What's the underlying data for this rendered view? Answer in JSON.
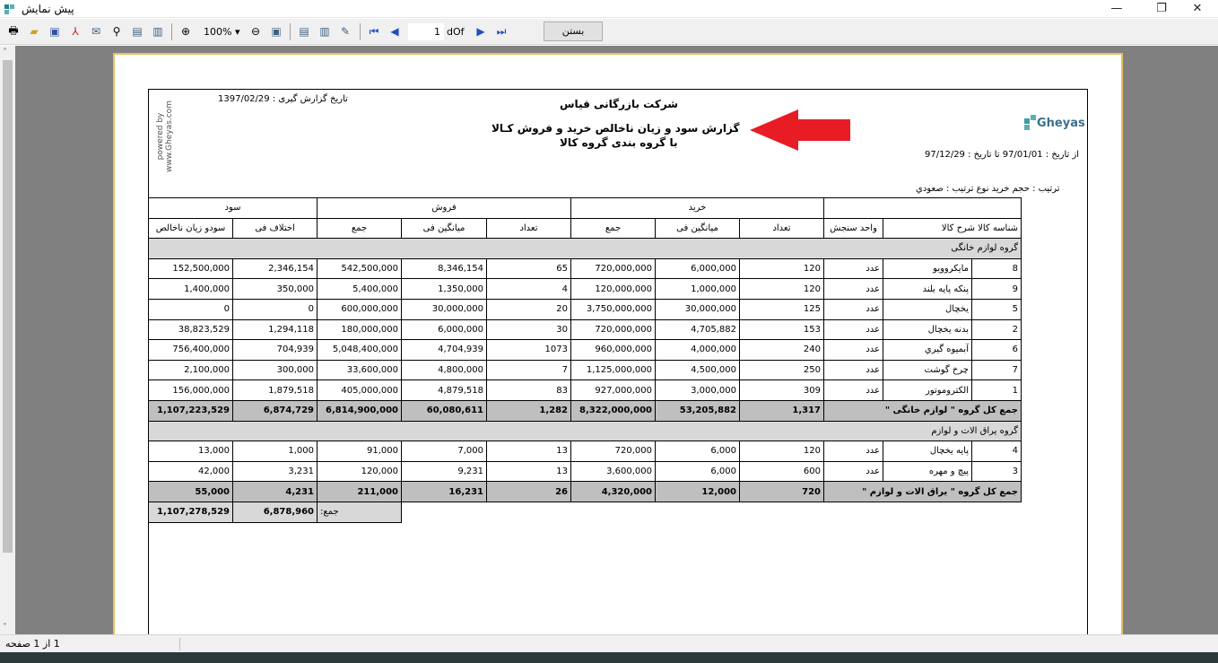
{
  "window": {
    "title": "پیش نمایش"
  },
  "toolbar": {
    "zoom": "100%",
    "page": "1",
    "of": "dOf",
    "close_label": "بستن"
  },
  "report": {
    "company": "شرکت بازرگانی قیاس",
    "title_line1": "گزارش سود و زیان ناخالص خرید و فروش کـالا",
    "title_line2": "با گروه بندی گروه کالا",
    "report_date": "تاریخ گزارش گیری : 1397/02/29",
    "date_range": "از تاریخ : 97/01/01   تا تاریخ : 97/12/29",
    "sort": "ترتیب : حجم خرید     نوع ترتیب : صعودي",
    "powered": "powered by",
    "powered_url": "www.Gheyas.com",
    "logo": "Gheyas",
    "grand_total_label": "جمع:",
    "grand_total_profit": "1,107,278,529",
    "grand_total_diff": "6,878,960"
  },
  "columns": {
    "group_buy": "خرید",
    "group_sell": "فروش",
    "group_profit": "سود",
    "id": "شناسه کالا",
    "desc": "شرح کالا",
    "unit": "واحد سنجش",
    "buy_qty": "تعداد",
    "buy_avg": "میانگین فی",
    "buy_sum": "جمع",
    "sell_qty": "تعداد",
    "sell_avg": "میانگین فی",
    "sell_sum": "جمع",
    "diff": "اختلاف فی",
    "profit": "سودو زیان ناخالص"
  },
  "groups": [
    {
      "name": "گروه لوازم خانگی",
      "rows": [
        [
          "8",
          "مایکروویو",
          "عدد",
          "120",
          "6,000,000",
          "720,000,000",
          "65",
          "8,346,154",
          "542,500,000",
          "2,346,154",
          "152,500,000"
        ],
        [
          "9",
          "پنکه پایه بلند",
          "عدد",
          "120",
          "1,000,000",
          "120,000,000",
          "4",
          "1,350,000",
          "5,400,000",
          "350,000",
          "1,400,000"
        ],
        [
          "5",
          "یخچال",
          "عدد",
          "125",
          "30,000,000",
          "3,750,000,000",
          "20",
          "30,000,000",
          "600,000,000",
          "0",
          "0"
        ],
        [
          "2",
          "بدنه یخچال",
          "عدد",
          "153",
          "4,705,882",
          "720,000,000",
          "30",
          "6,000,000",
          "180,000,000",
          "1,294,118",
          "38,823,529"
        ],
        [
          "6",
          "آبمیوه گیري",
          "عدد",
          "240",
          "4,000,000",
          "960,000,000",
          "1073",
          "4,704,939",
          "5,048,400,000",
          "704,939",
          "756,400,000"
        ],
        [
          "7",
          "چرخ گوشت",
          "عدد",
          "250",
          "4,500,000",
          "1,125,000,000",
          "7",
          "4,800,000",
          "33,600,000",
          "300,000",
          "2,100,000"
        ],
        [
          "1",
          "الکتروموتور",
          "عدد",
          "309",
          "3,000,000",
          "927,000,000",
          "83",
          "4,879,518",
          "405,000,000",
          "1,879,518",
          "156,000,000"
        ]
      ],
      "total": [
        "جمع کل گروه \" لوازم خانگی \"",
        "1,317",
        "53,205,882",
        "8,322,000,000",
        "1,282",
        "60,080,611",
        "6,814,900,000",
        "6,874,729",
        "1,107,223,529"
      ]
    },
    {
      "name": "گروه یراق الات و لوازم",
      "rows": [
        [
          "4",
          "پایه یخچال",
          "عدد",
          "120",
          "6,000",
          "720,000",
          "13",
          "7,000",
          "91,000",
          "1,000",
          "13,000"
        ],
        [
          "3",
          "پیچ و مهره",
          "عدد",
          "600",
          "6,000",
          "3,600,000",
          "13",
          "9,231",
          "120,000",
          "3,231",
          "42,000"
        ]
      ],
      "total": [
        "جمع کل گروه \" یراق الات و لوازم \"",
        "720",
        "12,000",
        "4,320,000",
        "26",
        "16,231",
        "211,000",
        "4,231",
        "55,000"
      ]
    }
  ],
  "status": {
    "page_label": "1 از 1 صفحه"
  }
}
